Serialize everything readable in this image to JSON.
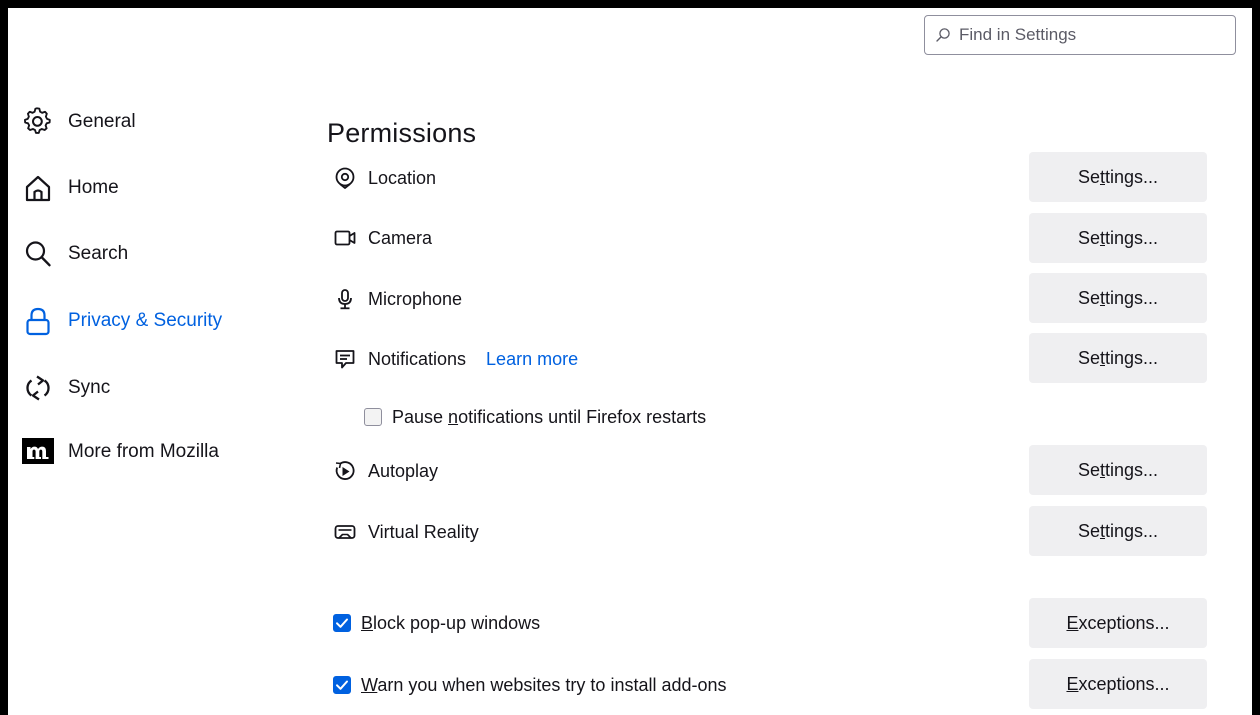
{
  "search": {
    "placeholder": "Find in Settings",
    "icon": "search-icon"
  },
  "sidebar": {
    "items": [
      {
        "label": "General",
        "icon": "gear-icon",
        "selected": false
      },
      {
        "label": "Home",
        "icon": "home-icon",
        "selected": false
      },
      {
        "label": "Search",
        "icon": "search-icon",
        "selected": false
      },
      {
        "label": "Privacy & Security",
        "icon": "lock-icon",
        "selected": true
      },
      {
        "label": "Sync",
        "icon": "sync-icon",
        "selected": false
      },
      {
        "label": "More from Mozilla",
        "icon": "mozilla-logo-icon",
        "selected": false
      }
    ]
  },
  "permissions": {
    "title": "Permissions",
    "rows": [
      {
        "label": "Location",
        "icon": "location-pin-icon",
        "button": "Settings..."
      },
      {
        "label": "Camera",
        "icon": "camera-icon",
        "button": "Settings..."
      },
      {
        "label": "Microphone",
        "icon": "microphone-icon",
        "button": "Settings..."
      },
      {
        "label": "Notifications",
        "icon": "notification-icon",
        "button": "Settings...",
        "link": "Learn more"
      },
      {
        "label": "Autoplay",
        "icon": "autoplay-icon",
        "button": "Settings..."
      },
      {
        "label": "Virtual Reality",
        "icon": "vr-headset-icon",
        "button": "Settings..."
      }
    ],
    "pause_notifications": {
      "label_pre": "Pause ",
      "label_key": "n",
      "label_post": "otifications until Firefox restarts",
      "checked": false
    },
    "settings_button": {
      "pre": "Se",
      "key": "t",
      "post": "tings..."
    },
    "exceptions_button": {
      "pre": "",
      "key": "E",
      "post": "xceptions..."
    },
    "block_popups": {
      "label_key": "B",
      "label_post": "lock pop-up windows",
      "checked": true,
      "button": "Exceptions..."
    },
    "warn_addons": {
      "label_key": "W",
      "label_post": "arn you when websites try to install add-ons",
      "checked": true,
      "button": "Exceptions..."
    }
  },
  "colors": {
    "accent": "#0061e0",
    "button_bg": "#efeff1",
    "text": "#15141a"
  }
}
